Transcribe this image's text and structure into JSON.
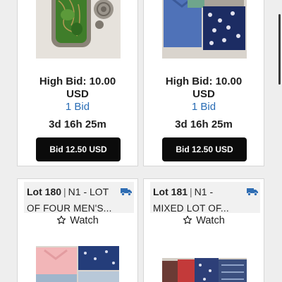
{
  "lots_top": [
    {
      "image_alt": "Green turquoise ring",
      "high_bid_line1": "High Bid: 10.00",
      "high_bid_line2": "USD",
      "bids_link": "1 Bid",
      "time_left": "3d 16h 25m",
      "bid_button": "Bid 12.50 USD"
    },
    {
      "image_alt": "Lot of men's shirts",
      "high_bid_line1": "High Bid: 10.00",
      "high_bid_line2": "USD",
      "bids_link": "1 Bid",
      "time_left": "3d 16h 25m",
      "bid_button": "Bid 12.50 USD"
    }
  ],
  "lots_bottom": [
    {
      "lot_label": "Lot 180",
      "title_line1": "N1 - LOT",
      "title_line2": "OF FOUR MEN'S...",
      "watch_label": "Watch"
    },
    {
      "lot_label": "Lot 181",
      "title_line1": "N1 -",
      "title_line2": "MIXED LOT OF...",
      "watch_label": "Watch"
    }
  ],
  "colors": {
    "link": "#2a6db5",
    "button_bg": "#0b0b0b",
    "shipping_icon": "#2f6db3"
  },
  "icons": {
    "shipping": "truck-icon",
    "watch": "star-outline-icon"
  }
}
